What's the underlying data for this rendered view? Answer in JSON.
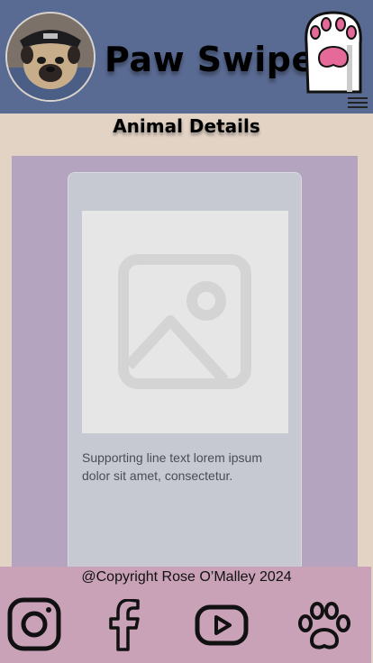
{
  "header": {
    "app_title": "Paw Swipe",
    "logo_icon": "paw-icon",
    "menu_icon": "hamburger-menu-icon",
    "colors": {
      "background": "#5a6b93",
      "paw_pad": "#e56a9a"
    }
  },
  "page": {
    "title": "Animal Details",
    "panel_color": "#b5a4c0",
    "background": "#e2d3c5"
  },
  "card": {
    "image_icon": "image-placeholder-icon",
    "supporting_text": "Supporting line text lorem ipsum dolor sit amet, consectetur."
  },
  "footer": {
    "copyright": "@Copyright Rose O’Malley 2024",
    "background": "#c9a2b8",
    "social_icons": [
      "instagram-icon",
      "facebook-icon",
      "youtube-icon",
      "paw-icon"
    ]
  }
}
